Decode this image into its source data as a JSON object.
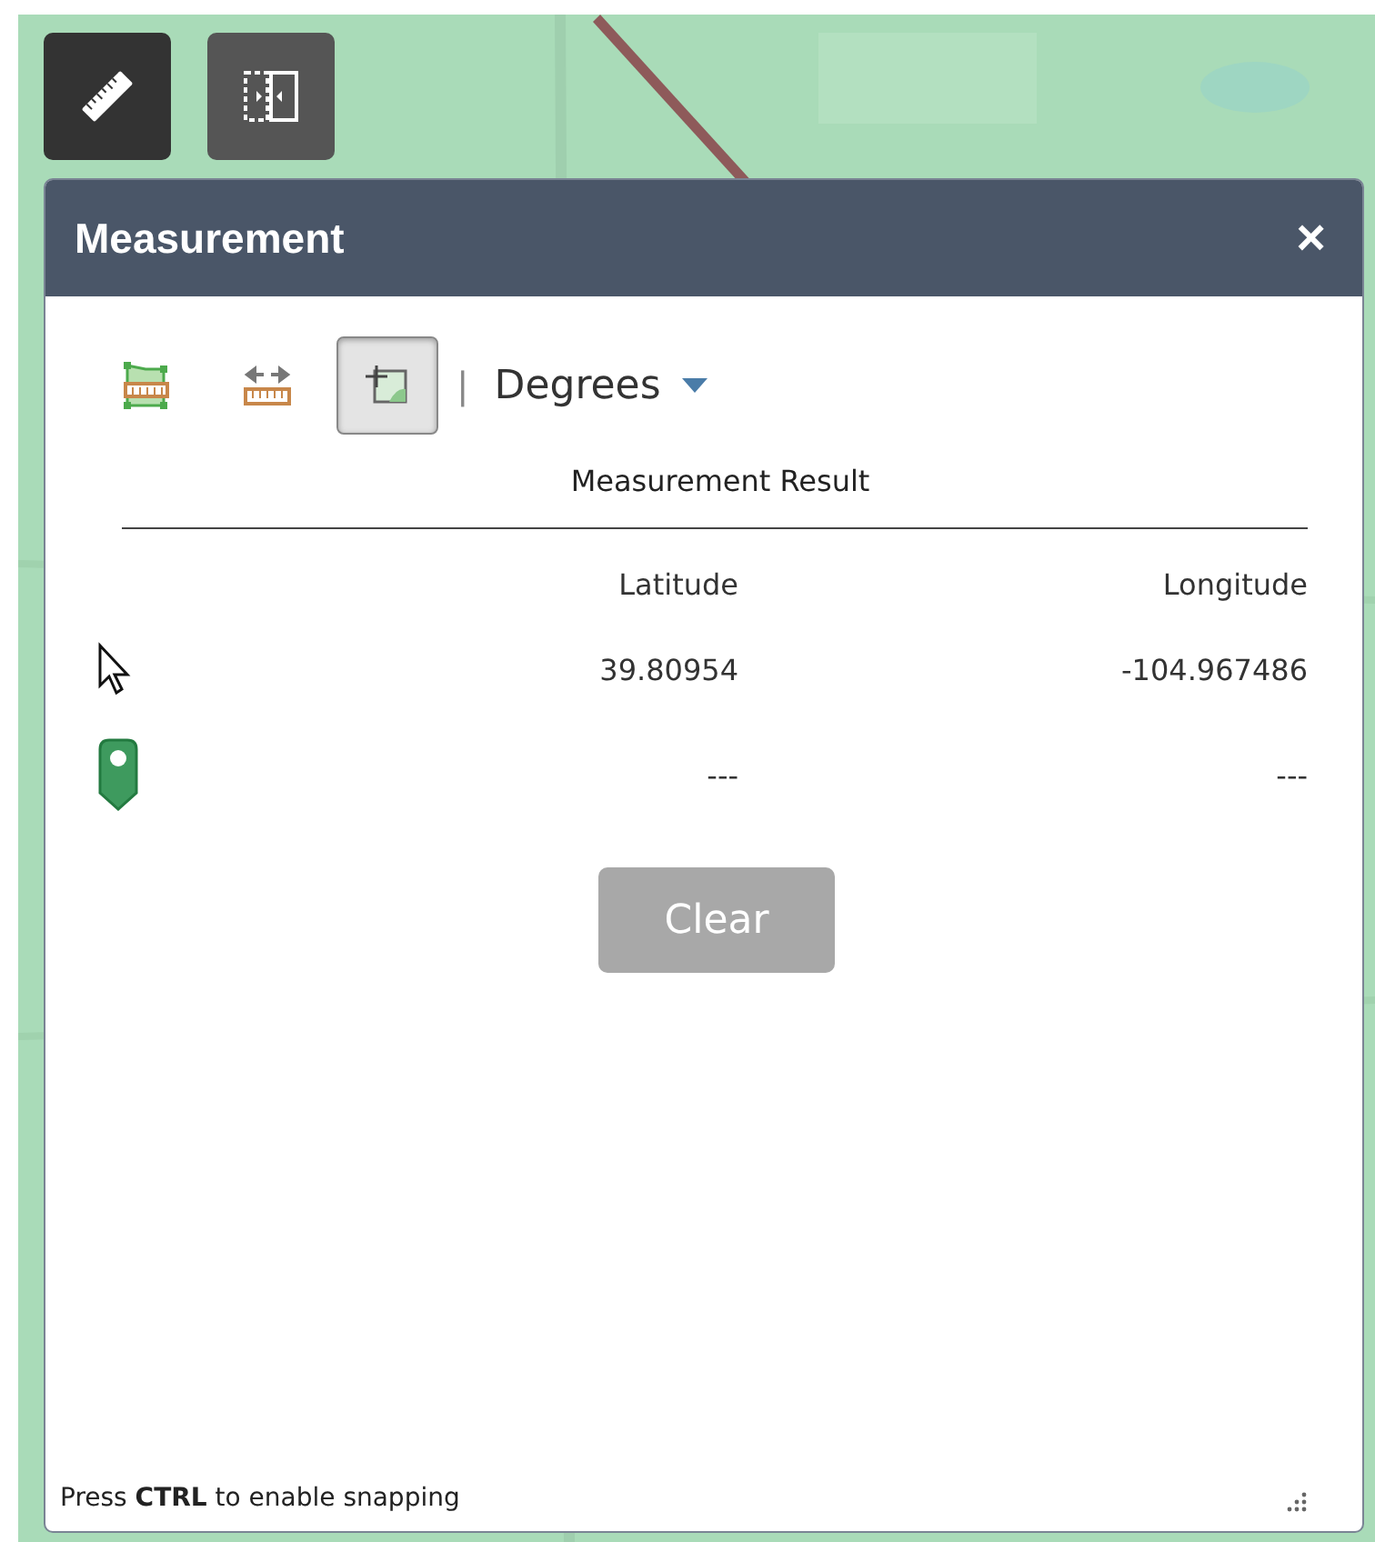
{
  "map_buttons": [
    {
      "kind": "ruler",
      "selected": true
    },
    {
      "kind": "swipe",
      "selected": false
    }
  ],
  "panel": {
    "title": "Measurement",
    "close": "×",
    "tools": [
      {
        "kind": "area",
        "selected": false
      },
      {
        "kind": "distance",
        "selected": false
      },
      {
        "kind": "location",
        "selected": true
      }
    ],
    "separator": "|",
    "unit": "Degrees",
    "result_title": "Measurement Result",
    "columns": [
      "Latitude",
      "Longitude"
    ],
    "rows": [
      {
        "kind": "cursor",
        "values": [
          "39.80954",
          "-104.967486"
        ]
      },
      {
        "kind": "pin",
        "values": [
          "---",
          "---"
        ]
      }
    ],
    "clear_button": {
      "label": "Clear",
      "disabled": true
    },
    "footer": "Press **CTRL** to enable snapping"
  }
}
